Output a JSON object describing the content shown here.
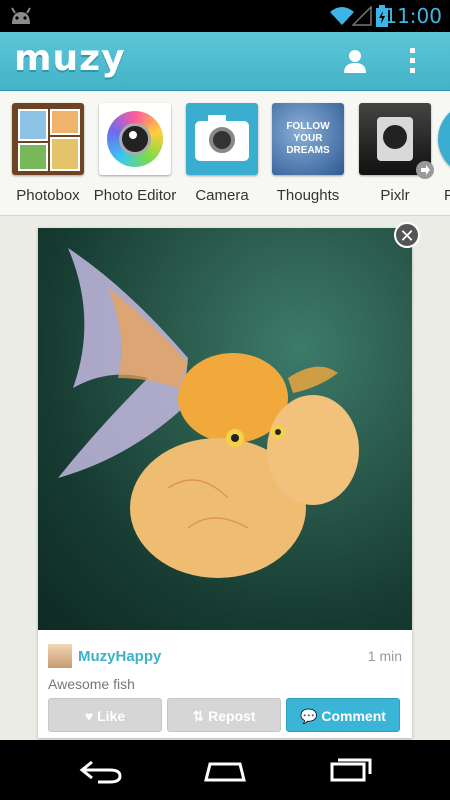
{
  "status_bar": {
    "time": "11:00"
  },
  "app_bar": {
    "logo": "muzy",
    "profile_icon": "person-icon",
    "menu_icon": "overflow-menu-icon"
  },
  "apps": [
    {
      "label": "Photobox",
      "icon": "photobox-icon"
    },
    {
      "label": "Photo Editor",
      "icon": "photo-editor-icon"
    },
    {
      "label": "Camera",
      "icon": "camera-icon"
    },
    {
      "label": "Thoughts",
      "icon": "thoughts-icon",
      "tile_text": "FOLLOW YOUR DREAMS"
    },
    {
      "label": "Pixlr",
      "icon": "pixlr-icon"
    },
    {
      "label": "P",
      "icon": "partial-app-icon"
    }
  ],
  "post": {
    "username": "MuzyHappy",
    "time_ago": "1 min",
    "caption": "Awesome fish",
    "actions": {
      "like": "Like",
      "repost": "Repost",
      "comment": "Comment"
    }
  },
  "colors": {
    "accent": "#43b3c8",
    "comment_button": "#3ab5d6",
    "button_gray": "#d6d6d6"
  }
}
